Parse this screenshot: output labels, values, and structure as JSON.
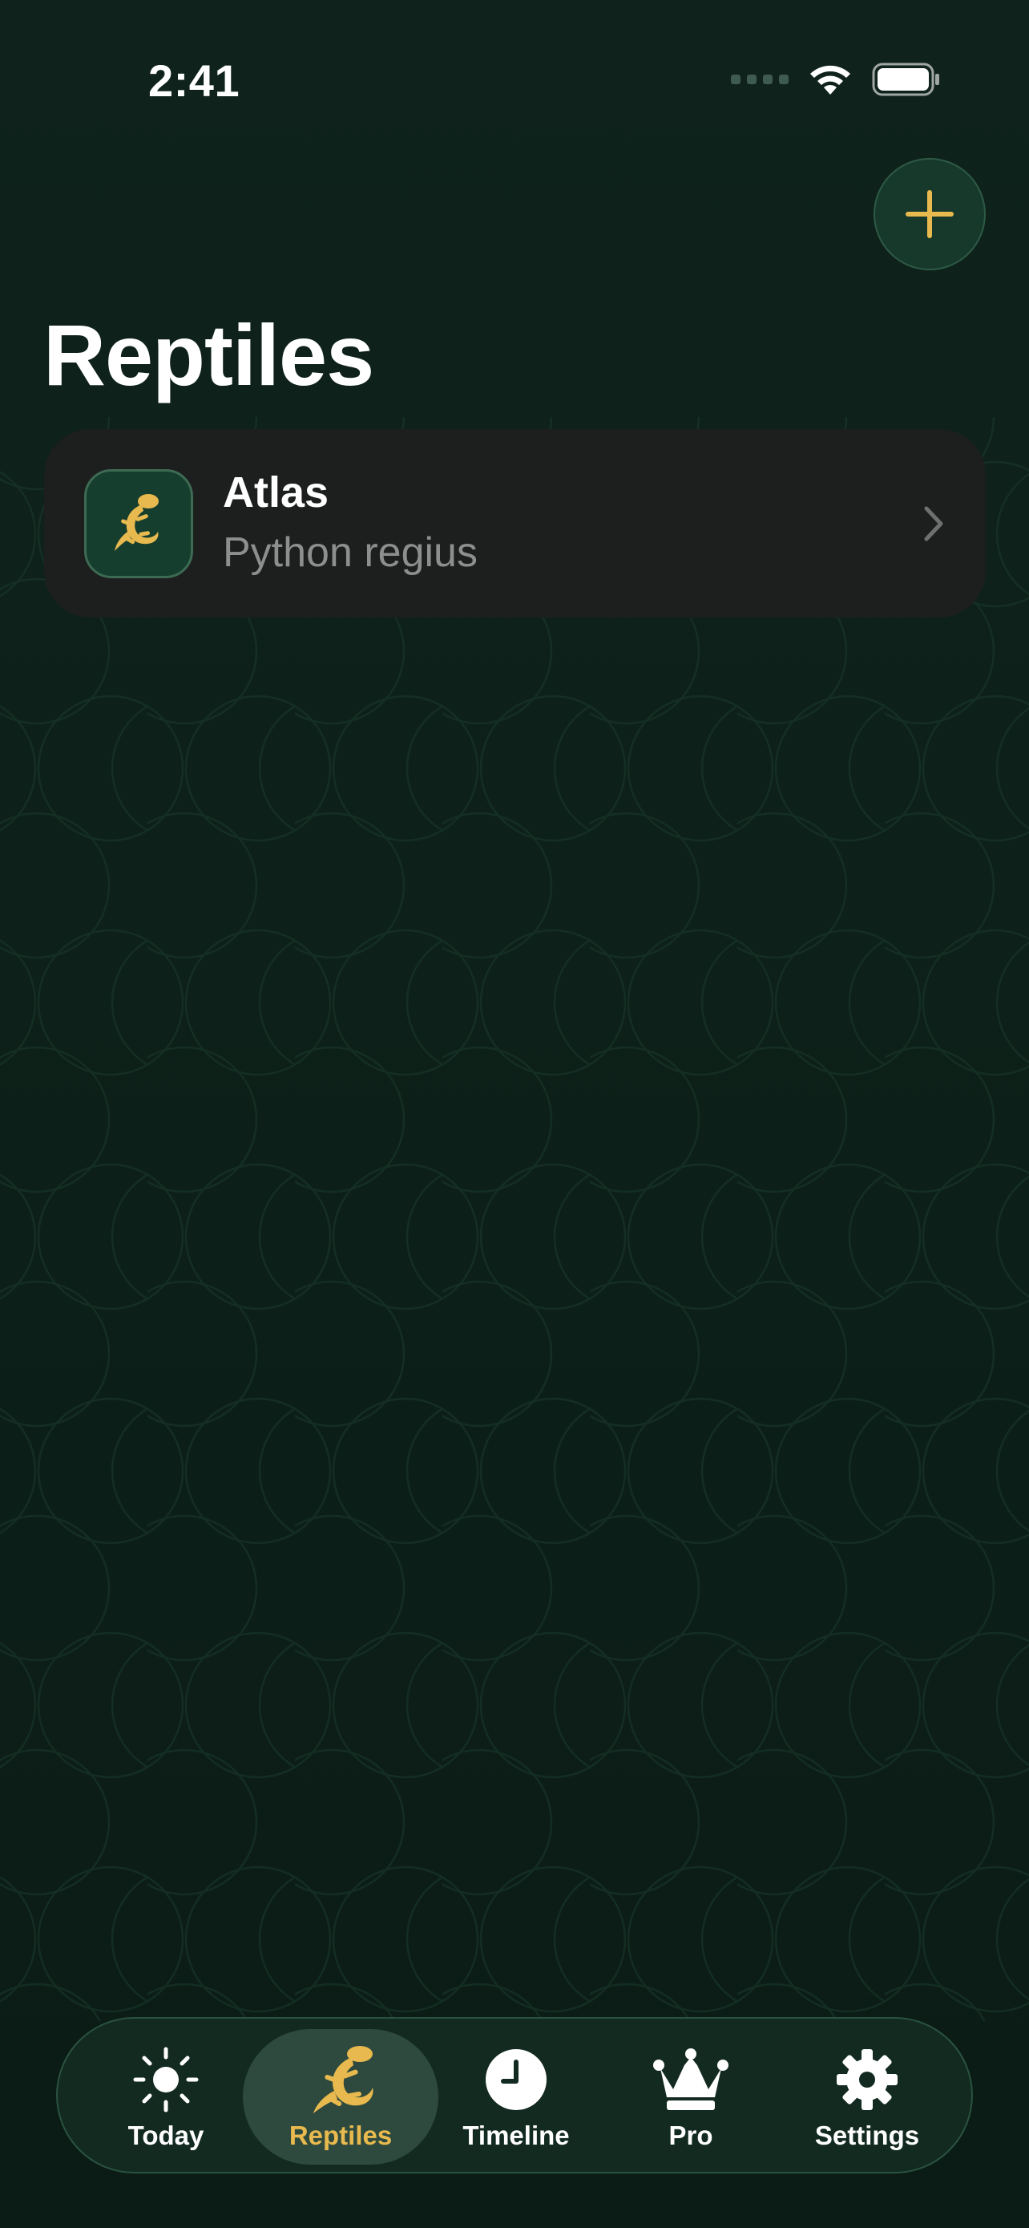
{
  "status_bar": {
    "time": "2:41"
  },
  "header": {
    "title": "Reptiles"
  },
  "reptiles": [
    {
      "name": "Atlas",
      "species": "Python regius",
      "icon": "lizard-icon"
    }
  ],
  "tabs": [
    {
      "label": "Today",
      "icon": "sun-icon",
      "active": false
    },
    {
      "label": "Reptiles",
      "icon": "lizard-icon",
      "active": true
    },
    {
      "label": "Timeline",
      "icon": "clock-icon",
      "active": false
    },
    {
      "label": "Pro",
      "icon": "crown-icon",
      "active": false
    },
    {
      "label": "Settings",
      "icon": "gear-icon",
      "active": false
    }
  ],
  "colors": {
    "accent": "#e8b94e",
    "background": "#0d2019",
    "card": "#1d1f1f",
    "tab_active_bg": "#2e4a3e"
  }
}
